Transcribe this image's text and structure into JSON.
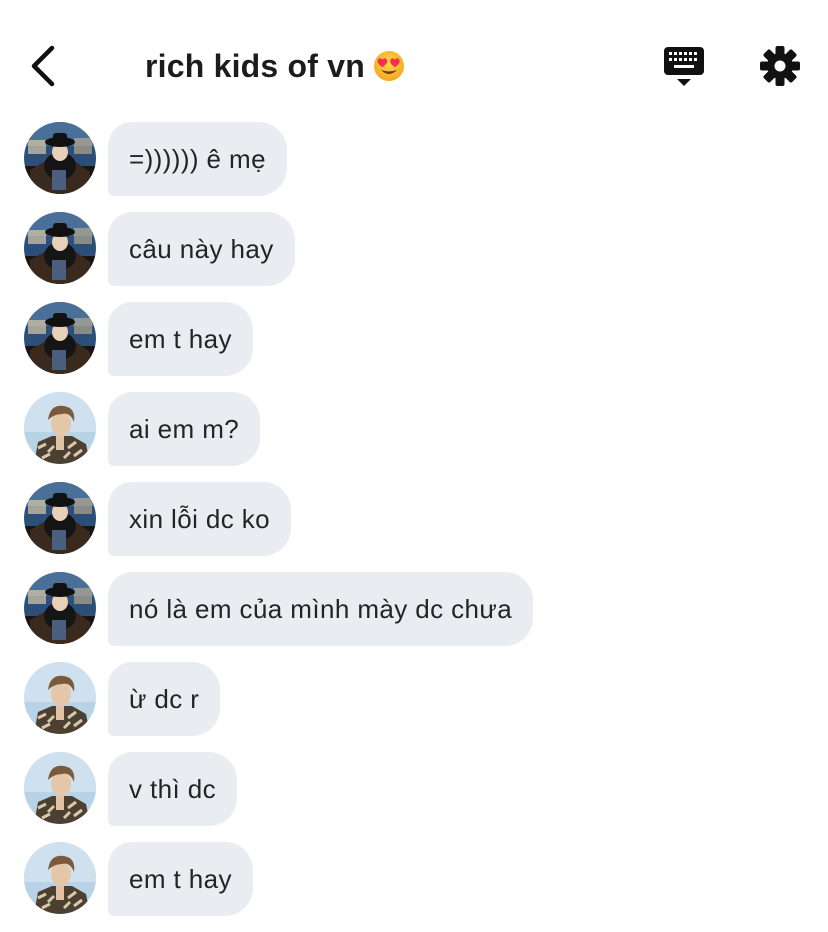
{
  "header": {
    "title": "rich kids of vn",
    "emoji": "😍"
  },
  "messages": [
    {
      "avatar": "user-a",
      "text": "=)))))) ê mẹ"
    },
    {
      "avatar": "user-a",
      "text": "câu này hay"
    },
    {
      "avatar": "user-a",
      "text": "em t hay"
    },
    {
      "avatar": "user-b",
      "text": "ai em m?"
    },
    {
      "avatar": "user-a",
      "text": "xin lỗi dc ko"
    },
    {
      "avatar": "user-a",
      "text": "nó là em của mình mày dc chưa"
    },
    {
      "avatar": "user-b",
      "text": "ừ dc r"
    },
    {
      "avatar": "user-b",
      "text": "v thì dc"
    },
    {
      "avatar": "user-b",
      "text": "em t hay"
    }
  ],
  "icons": {
    "back": "chevron-left-icon",
    "keyboard": "keyboard-icon",
    "settings": "gear-icon"
  },
  "colors": {
    "bubble": "#e9edf1",
    "text": "#1c1c1e",
    "background": "#ffffff"
  }
}
